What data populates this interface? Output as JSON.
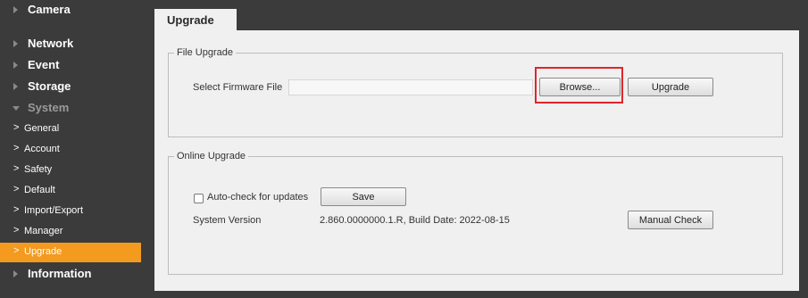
{
  "sidebar": {
    "items": [
      {
        "label": "Camera"
      },
      {
        "label": "Network"
      },
      {
        "label": "Event"
      },
      {
        "label": "Storage"
      },
      {
        "label": "System"
      },
      {
        "label": "Information"
      }
    ],
    "system_sub": [
      {
        "label": "General"
      },
      {
        "label": "Account"
      },
      {
        "label": "Safety"
      },
      {
        "label": "Default"
      },
      {
        "label": "Import/Export"
      },
      {
        "label": "Manager"
      },
      {
        "label": "Upgrade"
      }
    ],
    "chevron": ">"
  },
  "tab": {
    "title": "Upgrade"
  },
  "file_upgrade": {
    "legend": "File Upgrade",
    "label": "Select Firmware File",
    "value": "",
    "browse": "Browse...",
    "upgrade": "Upgrade"
  },
  "online_upgrade": {
    "legend": "Online Upgrade",
    "auto_check": "Auto-check for updates",
    "save": "Save",
    "version_label": "System Version",
    "version_value": "2.860.0000000.1.R, Build Date: 2022-08-15",
    "manual_check": "Manual Check"
  },
  "colors": {
    "accent": "#f39a1f",
    "highlight": "#e0252b",
    "sidebar_bg": "#3b3b3b"
  }
}
